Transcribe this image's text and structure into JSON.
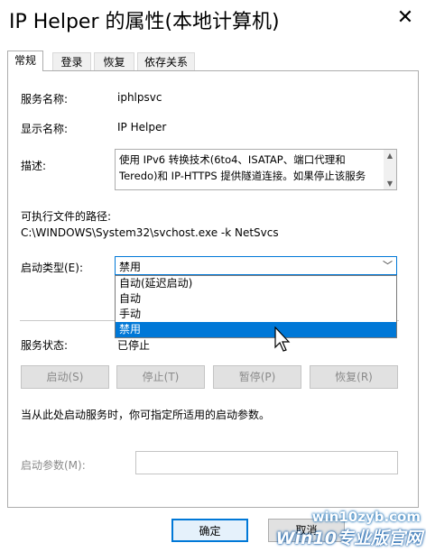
{
  "window": {
    "title": "IP Helper 的属性(本地计算机)",
    "close_label": "✕"
  },
  "tabs": [
    {
      "label": "常规"
    },
    {
      "label": "登录"
    },
    {
      "label": "恢复"
    },
    {
      "label": "依存关系"
    }
  ],
  "general": {
    "service_name_label": "服务名称:",
    "service_name": "iphlpsvc",
    "display_name_label": "显示名称:",
    "display_name": "IP Helper",
    "description_label": "描述:",
    "description": "使用 IPv6 转换技术(6to4、ISATAP、端口代理和\nTeredo)和 IP-HTTPS 提供隧道连接。如果停止该服务",
    "path_label": "可执行文件的路径:",
    "path": "C:\\WINDOWS\\System32\\svchost.exe -k NetSvcs",
    "startup_type_label": "启动类型(E):",
    "startup_type_value": "禁用",
    "startup_options": [
      "自动(延迟启动)",
      "自动",
      "手动",
      "禁用"
    ],
    "status_label": "服务状态:",
    "status_value": "已停止",
    "buttons": {
      "start": "启动(S)",
      "stop": "停止(T)",
      "pause": "暂停(P)",
      "resume": "恢复(R)"
    },
    "hint": "当从此处启动服务时，你可指定所适用的启动参数。",
    "params_label": "启动参数(M):",
    "params_value": ""
  },
  "footer": {
    "ok": "确定",
    "cancel": "取消"
  },
  "watermark": {
    "url": "win10zyb.com",
    "brand": "Win10专业版官网"
  },
  "colors": {
    "accent": "#0078d7",
    "selected_text": "#ffffff",
    "disabled_text": "#8a8a8a"
  }
}
